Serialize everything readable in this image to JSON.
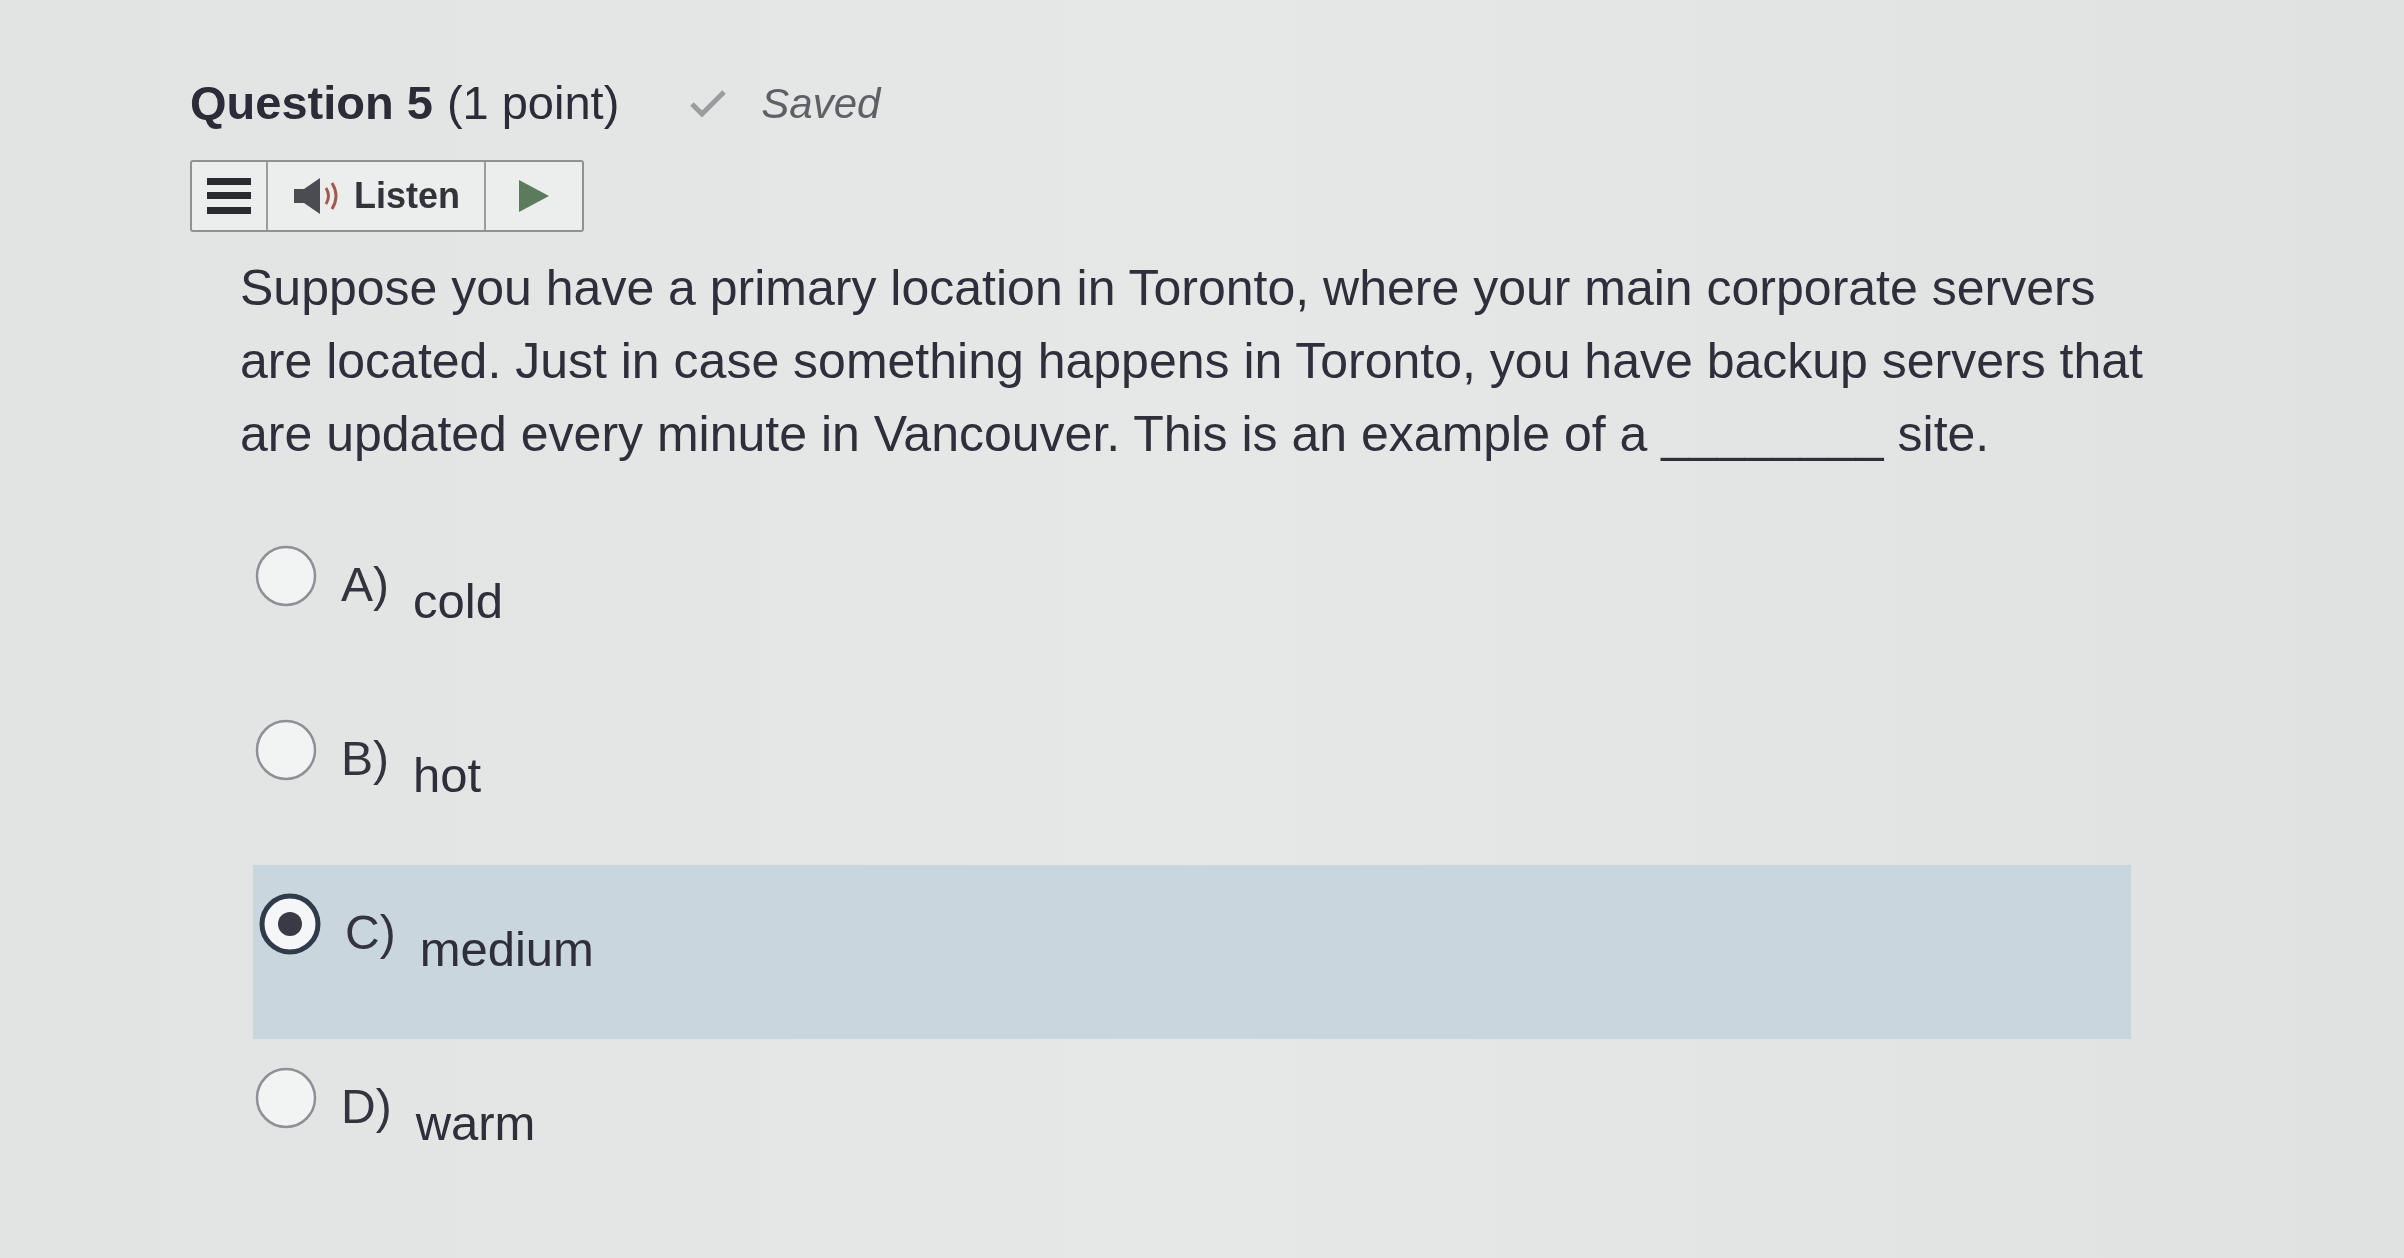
{
  "question": {
    "title": "Question 5",
    "points": "(1 point)",
    "status": "Saved"
  },
  "toolbar": {
    "listen_label": "Listen"
  },
  "prompt_lines": [
    "Suppose you have a primary location in Toronto, where your main corporate servers",
    "are located. Just in case something happens in Toronto, you have backup servers that",
    "are updated every minute in Vancouver. This is an example of a ________ site."
  ],
  "options": [
    {
      "letter": "A)",
      "text": "cold",
      "selected": false
    },
    {
      "letter": "B)",
      "text": "hot",
      "selected": false
    },
    {
      "letter": "C)",
      "text": "medium",
      "selected": true
    },
    {
      "letter": "D)",
      "text": "warm",
      "selected": false
    }
  ]
}
